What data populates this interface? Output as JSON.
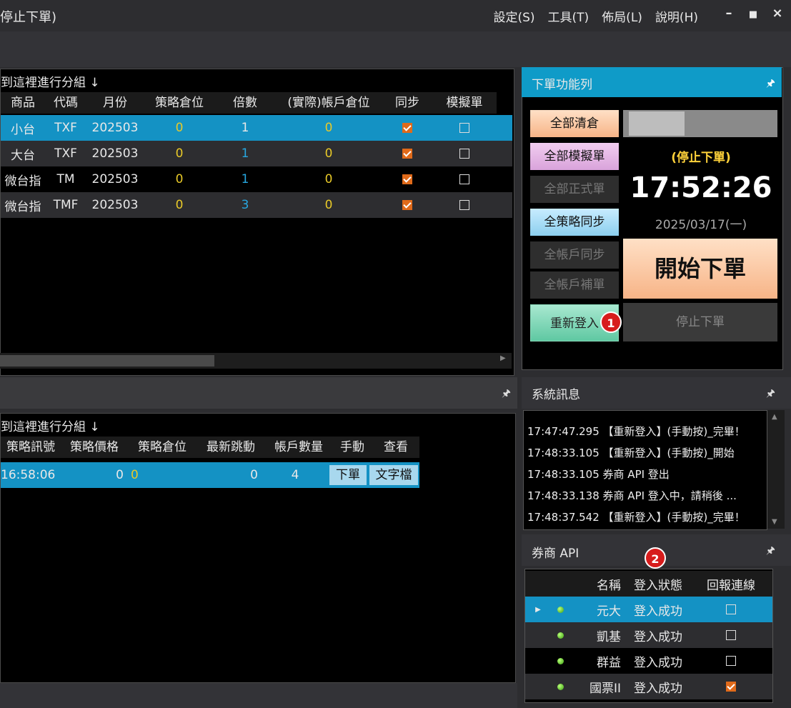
{
  "window": {
    "title": "停止下單)",
    "menu": [
      "設定(S)",
      "工具(T)",
      "佈局(L)",
      "說明(H)"
    ],
    "controls": {
      "minimize": "–",
      "maximize": "■",
      "close": "×"
    }
  },
  "strategy_grid": {
    "group_hint": "到這裡進行分組 ↓",
    "columns": [
      "商品",
      "代碼",
      "月份",
      "策略倉位",
      "倍數",
      "(實際)帳戶倉位",
      "同步",
      "模擬單"
    ],
    "rows": [
      {
        "product": "小台",
        "code": "TXF",
        "month": "202503",
        "pos": "0",
        "mult": "1",
        "acct": "0",
        "sync": true,
        "sim": false
      },
      {
        "product": "大台",
        "code": "TXF",
        "month": "202503",
        "pos": "0",
        "mult": "1",
        "acct": "0",
        "sync": true,
        "sim": false
      },
      {
        "product": "微台指",
        "code": "TM",
        "month": "202503",
        "pos": "0",
        "mult": "1",
        "acct": "0",
        "sync": true,
        "sim": false
      },
      {
        "product": "微台指",
        "code": "TMF",
        "month": "202503",
        "pos": "0",
        "mult": "3",
        "acct": "0",
        "sync": true,
        "sim": false
      }
    ]
  },
  "signal_grid": {
    "group_hint": "到這裡進行分組 ↓",
    "columns": [
      "策略訊號",
      "策略價格",
      "策略倉位",
      "最新跳動",
      "帳戶數量",
      "手動",
      "查看"
    ],
    "rows": [
      {
        "signal": "16:58:06",
        "price": "0",
        "pos": "0",
        "tick": "0",
        "qty": "4",
        "order_btn": "下單",
        "file_btn": "文字檔"
      }
    ]
  },
  "order_panel": {
    "title": "下單功能列",
    "buttons": {
      "close_all": "全部清倉",
      "all_sim": "全部模擬單",
      "all_real": "全部正式單",
      "strat_sync": "全策略同步",
      "acct_sync": "全帳戶同步",
      "acct_fill": "全帳戶補單",
      "relogin": "重新登入"
    },
    "status": "(停止下單)",
    "clock": "17:52:26",
    "date": "2025/03/17(一)",
    "start": "開始下單",
    "stop": "停止下單"
  },
  "badges": {
    "one": "1",
    "two": "2"
  },
  "system_messages": {
    "title": "系統訊息",
    "lines": [
      "17:47:47.295 【重新登入】(手動按)_完畢！",
      "17:48:33.105 【重新登入】(手動按)_開始",
      "17:48:33.105 券商 API 登出",
      "17:48:33.138 券商 API 登入中，請稍後 ...",
      "17:48:37.542 【重新登入】(手動按)_完畢！"
    ]
  },
  "broker_api": {
    "title": "券商 API",
    "columns": [
      "名稱",
      "登入狀態",
      "回報連線"
    ],
    "rows": [
      {
        "name": "元大",
        "status": "登入成功",
        "report": false
      },
      {
        "name": "凱基",
        "status": "登入成功",
        "report": false
      },
      {
        "name": "群益",
        "status": "登入成功",
        "report": false
      },
      {
        "name": "國票II",
        "status": "登入成功",
        "report": true
      }
    ]
  },
  "icons": {
    "pin": "pin-icon",
    "row_pointer": "row-pointer-icon",
    "status_dot": "green-dot-icon"
  },
  "colors": {
    "accent": "#0f9bc8",
    "position_yellow": "#e8c928",
    "multiplier_blue": "#27a7e0",
    "checkbox_orange": "#e06a1a"
  }
}
